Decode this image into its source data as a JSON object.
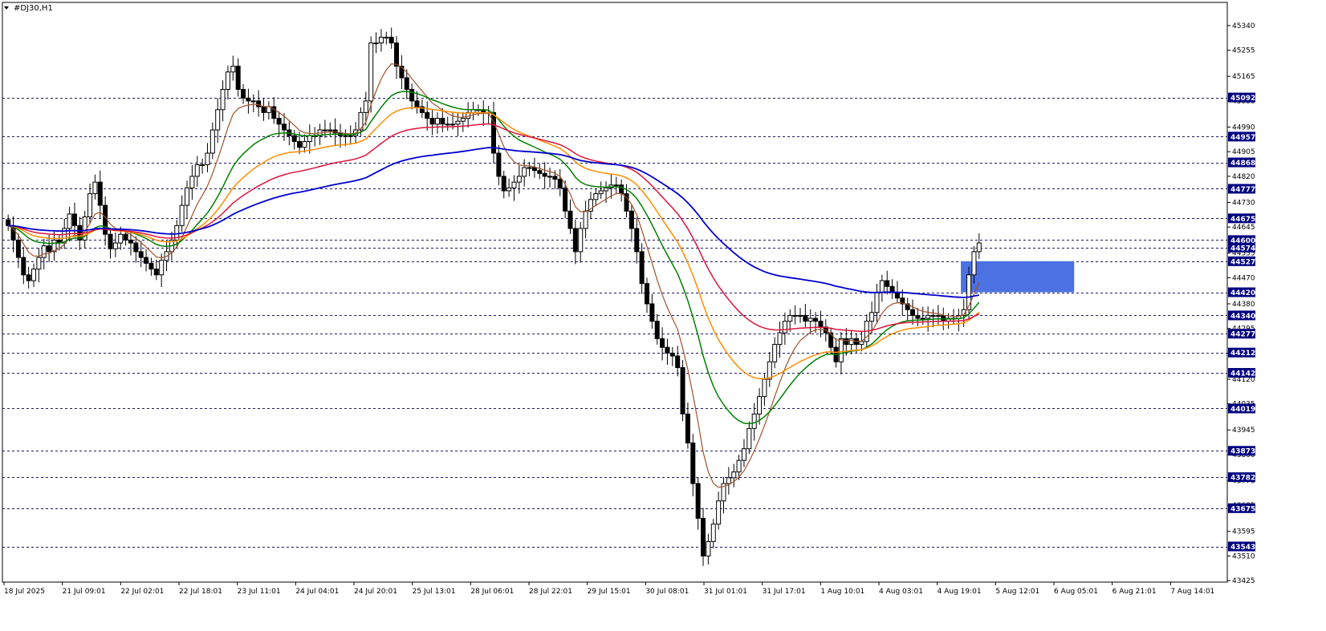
{
  "chart_data": {
    "type": "candlestick",
    "symbol_label": "#DJ30,H1",
    "ylim": [
      43420,
      45420
    ],
    "y_ticks": [
      45340,
      45255,
      45165,
      45080,
      44990,
      44905,
      44820,
      44730,
      44645,
      44555,
      44470,
      44380,
      44295,
      44210,
      44120,
      44035,
      43945,
      43860,
      43770,
      43685,
      43595,
      43510,
      43425
    ],
    "x_labels": [
      "18 Jul 2025",
      "21 Jul 09:01",
      "22 Jul 02:01",
      "22 Jul 18:01",
      "23 Jul 11:01",
      "24 Jul 04:01",
      "24 Jul 20:01",
      "25 Jul 13:01",
      "28 Jul 06:01",
      "28 Jul 22:01",
      "29 Jul 15:01",
      "30 Jul 08:01",
      "31 Jul 01:01",
      "31 Jul 17:01",
      "1 Aug 10:01",
      "4 Aug 03:01",
      "4 Aug 19:01",
      "5 Aug 12:01",
      "6 Aug 05:01",
      "6 Aug 21:01",
      "7 Aug 14:01"
    ],
    "levels": [
      45092,
      44957,
      44868,
      44777,
      44675,
      44600,
      44574,
      44527,
      44420,
      44340,
      44277,
      44212,
      44142,
      44019,
      43873,
      43782,
      43675,
      43543
    ],
    "zone": {
      "x_start": 1.565,
      "x_end": 1.75,
      "y_low": 44420,
      "y_high": 44527,
      "color": "#4169E1"
    },
    "colors": {
      "bull": "#000000",
      "bear": "#000000",
      "level_line": "#1a1a66",
      "level_tag": "#000080",
      "grid_text": "#000000"
    },
    "closes": [
      44650,
      44600,
      44540,
      44480,
      44460,
      44500,
      44540,
      44580,
      44560,
      44600,
      44590,
      44640,
      44690,
      44650,
      44600,
      44680,
      44760,
      44800,
      44720,
      44620,
      44570,
      44590,
      44620,
      44600,
      44590,
      44560,
      44540,
      44520,
      44500,
      44480,
      44530,
      44560,
      44600,
      44650,
      44720,
      44780,
      44820,
      44860,
      44860,
      44900,
      44980,
      45050,
      45120,
      45180,
      45200,
      45120,
      45090,
      45080,
      45080,
      45060,
      45040,
      45060,
      45020,
      45000,
      44980,
      44960,
      44940,
      44920,
      44940,
      44960,
      44960,
      44980,
      44980,
      44980,
      44970,
      44960,
      44960,
      44960,
      44980,
      45040,
      45080,
      45280,
      45280,
      45300,
      45300,
      45280,
      45200,
      45160,
      45120,
      45080,
      45060,
      45040,
      45020,
      45000,
      45020,
      45000,
      45000,
      45000,
      45010,
      45020,
      45040,
      45050,
      45050,
      45040,
      45040,
      44900,
      44820,
      44770,
      44780,
      44800,
      44820,
      44850,
      44850,
      44840,
      44830,
      44820,
      44820,
      44810,
      44780,
      44700,
      44640,
      44560,
      44640,
      44700,
      44740,
      44760,
      44770,
      44780,
      44790,
      44790,
      44760,
      44700,
      44640,
      44560,
      44450,
      44380,
      44320,
      44260,
      44230,
      44210,
      44200,
      44160,
      44000,
      43900,
      43760,
      43640,
      43510,
      43560,
      43620,
      43700,
      43760,
      43780,
      43800,
      43840,
      43880,
      43950,
      44000,
      44060,
      44120,
      44180,
      44240,
      44280,
      44320,
      44340,
      44340,
      44340,
      44320,
      44330,
      44320,
      44300,
      44280,
      44230,
      44180,
      44260,
      44240,
      44260,
      44240,
      44250,
      44320,
      44350,
      44420,
      44460,
      44440,
      44420,
      44400,
      44380,
      44360,
      44340,
      44330,
      44330,
      44340,
      44340,
      44340,
      44320,
      44330,
      44330,
      44340,
      44360,
      44480,
      44560,
      44590
    ]
  }
}
